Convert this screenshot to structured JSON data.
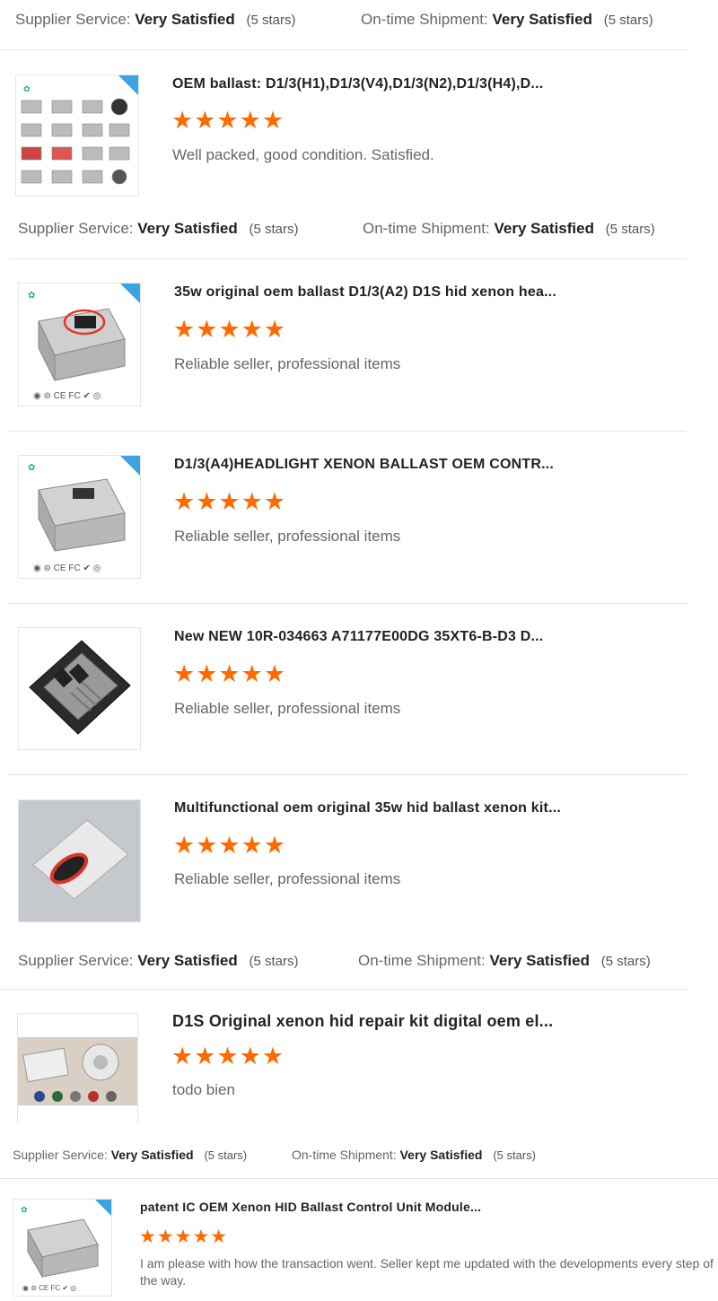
{
  "labels": {
    "supplier_service": "Supplier Service:",
    "ontime_shipment": "On-time Shipment:"
  },
  "rating_rows": [
    {
      "supplier_value": "Very Satisfied",
      "supplier_stars": "(5 stars)",
      "shipment_value": "Very Satisfied",
      "shipment_stars": "(5 stars)"
    },
    {
      "supplier_value": "Very Satisfied",
      "supplier_stars": "(5 stars)",
      "shipment_value": "Very Satisfied",
      "shipment_stars": "(5 stars)"
    },
    {
      "supplier_value": "Very Satisfied",
      "supplier_stars": "(5 stars)",
      "shipment_value": "Very Satisfied",
      "shipment_stars": "(5 stars)"
    },
    {
      "supplier_value": "Very Satisfied",
      "supplier_stars": "(5 stars)",
      "shipment_value": "Very Satisfied",
      "shipment_stars": "(5 stars)"
    }
  ],
  "reviews": [
    {
      "title": "OEM ballast: D1/3(H1),D1/3(V4),D1/3(N2),D1/3(H4),D...",
      "rating": 5,
      "stars": "★★★★★",
      "comment": "Well packed, good condition. Satisfied.",
      "image": "ballast-catalog-grid"
    },
    {
      "title": "35w original oem ballast D1/3(A2) D1S hid xenon hea...",
      "rating": 5,
      "stars": "★★★★★",
      "comment": "Reliable seller, professional items",
      "image": "silver-ballast-circled"
    },
    {
      "title": "D1/3(A4)HEADLIGHT XENON BALLAST OEM CONTR...",
      "rating": 5,
      "stars": "★★★★★",
      "comment": "Reliable seller, professional items",
      "image": "silver-ballast"
    },
    {
      "title": "New NEW 10R-034663 A71177E00DG 35XT6-B-D3 D...",
      "rating": 5,
      "stars": "★★★★★",
      "comment": "Reliable seller, professional items",
      "image": "black-ballast"
    },
    {
      "title": "Multifunctional oem original 35w hid ballast xenon kit...",
      "rating": 5,
      "stars": "★★★★★",
      "comment": "Reliable seller, professional items",
      "image": "grey-ballast-red-connector"
    },
    {
      "title": "D1S Original xenon hid repair kit digital oem el...",
      "rating": 5,
      "stars": "★★★★★",
      "comment": "todo bien",
      "image": "repair-kit"
    },
    {
      "title": "patent IC OEM Xenon HID Ballast Control Unit Module...",
      "rating": 5,
      "stars": "★★★★★",
      "comment": "I am please with how the transaction went. Seller kept me updated with the developments every step of the way.",
      "image": "silver-ballast"
    }
  ],
  "colors": {
    "star": "#ff6a00",
    "ribbon": "#3aa3e0",
    "divider": "#e3e3e3"
  }
}
